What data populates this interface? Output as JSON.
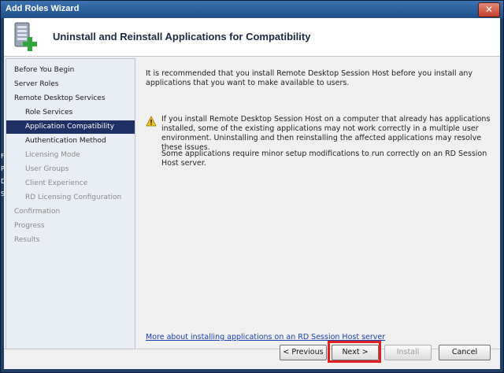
{
  "window": {
    "title": "Add Roles Wizard",
    "close_glyph": "✕"
  },
  "header": {
    "title": "Uninstall and Reinstall Applications for Compatibility",
    "icon": "server-add-icon"
  },
  "nav": {
    "items": [
      {
        "label": "Before You Begin",
        "state": "normal",
        "level": "top"
      },
      {
        "label": "Server Roles",
        "state": "normal",
        "level": "top"
      },
      {
        "label": "Remote Desktop Services",
        "state": "normal",
        "level": "top"
      },
      {
        "label": "Role Services",
        "state": "normal",
        "level": "sub"
      },
      {
        "label": "Application Compatibility",
        "state": "active",
        "level": "sub"
      },
      {
        "label": "Authentication Method",
        "state": "normal",
        "level": "sub"
      },
      {
        "label": "Licensing Mode",
        "state": "disabled",
        "level": "sub"
      },
      {
        "label": "User Groups",
        "state": "disabled",
        "level": "sub"
      },
      {
        "label": "Client Experience",
        "state": "disabled",
        "level": "sub"
      },
      {
        "label": "RD Licensing Configuration",
        "state": "disabled",
        "level": "sub"
      },
      {
        "label": "Confirmation",
        "state": "disabled",
        "level": "top"
      },
      {
        "label": "Progress",
        "state": "disabled",
        "level": "top"
      },
      {
        "label": "Results",
        "state": "disabled",
        "level": "top"
      }
    ]
  },
  "content": {
    "intro": "It is recommended that you install Remote Desktop Session Host before you install any applications that you want to make available to users.",
    "warning": "If you install Remote Desktop Session Host on a computer that already has applications installed, some of the existing applications may not work correctly in a multiple user environment. Uninstalling and then reinstalling the affected applications may resolve these issues.",
    "note": "Some applications require minor setup modifications to run correctly on an RD Session Host server.",
    "link": "More about installing applications on an RD Session Host server"
  },
  "buttons": {
    "previous": "< Previous",
    "next": "Next >",
    "install": "Install",
    "cancel": "Cancel"
  },
  "background_text": [
    "F",
    "P",
    "D",
    "S"
  ],
  "colors": {
    "active_nav": "#1e3064",
    "highlight": "#e02020",
    "link": "#1a3fb0"
  }
}
